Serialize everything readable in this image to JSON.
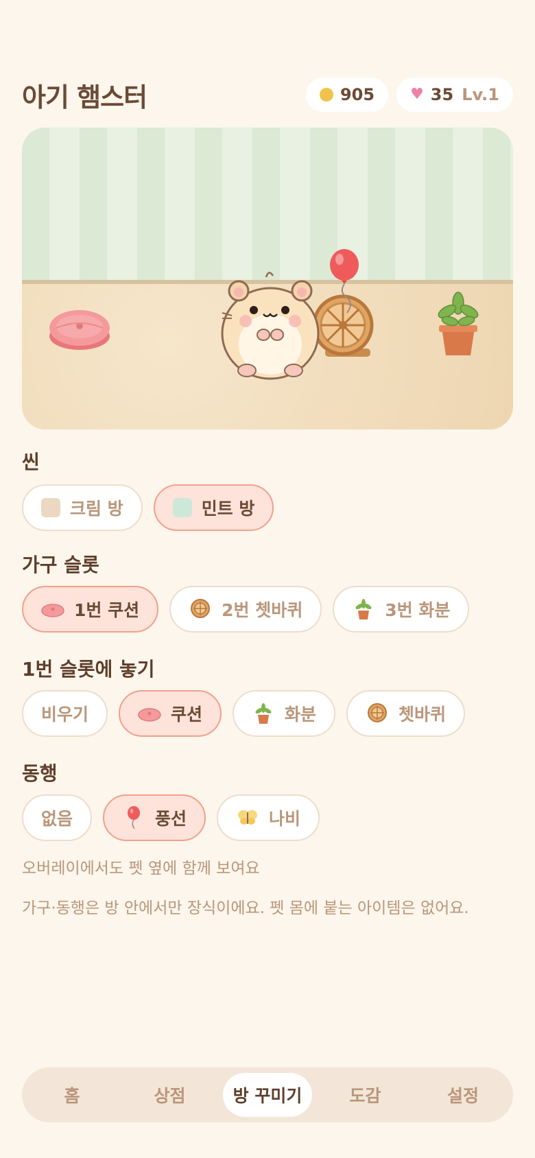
{
  "header": {
    "title": "아기 햄스터",
    "coins": "905",
    "hearts": "35",
    "level": "Lv.1"
  },
  "scene": {
    "label": "씬",
    "options": [
      {
        "label": "크림 방",
        "swatch": "#ecd8c0",
        "selected": false
      },
      {
        "label": "민트 방",
        "swatch": "#cde8d8",
        "selected": true
      }
    ]
  },
  "furniture_slots": {
    "label": "가구 슬롯",
    "options": [
      {
        "label": "1번 쿠션",
        "icon": "cushion-icon",
        "selected": true
      },
      {
        "label": "2번 쳇바퀴",
        "icon": "wheel-icon",
        "selected": false
      },
      {
        "label": "3번 화분",
        "icon": "plant-icon",
        "selected": false
      }
    ]
  },
  "place_in_slot": {
    "label": "1번 슬롯에 놓기",
    "options": [
      {
        "label": "비우기",
        "icon": null,
        "selected": false
      },
      {
        "label": "쿠션",
        "icon": "cushion-icon",
        "selected": true
      },
      {
        "label": "화분",
        "icon": "plant-icon",
        "selected": false
      },
      {
        "label": "쳇바퀴",
        "icon": "wheel-icon",
        "selected": false
      }
    ]
  },
  "companion": {
    "label": "동행",
    "options": [
      {
        "label": "없음",
        "icon": null,
        "selected": false
      },
      {
        "label": "풍선",
        "icon": "balloon-icon",
        "selected": true
      },
      {
        "label": "나비",
        "icon": "butterfly-icon",
        "selected": false
      }
    ],
    "note": "오버레이에서도 펫 옆에 함께 보여요"
  },
  "footer_note": "가구·동행은 방 안에서만 장식이에요. 펫 몸에 붙는 아이템은 없어요.",
  "tabs": [
    {
      "label": "홈",
      "active": false
    },
    {
      "label": "상점",
      "active": false
    },
    {
      "label": "방 꾸미기",
      "active": true
    },
    {
      "label": "도감",
      "active": false
    },
    {
      "label": "설정",
      "active": false
    }
  ],
  "colors": {
    "background": "#fcf6ec",
    "selected_fill": "#fde3da",
    "selected_border": "#f2a08a",
    "coin": "#f0c44c",
    "heart": "#ef7fa4"
  }
}
